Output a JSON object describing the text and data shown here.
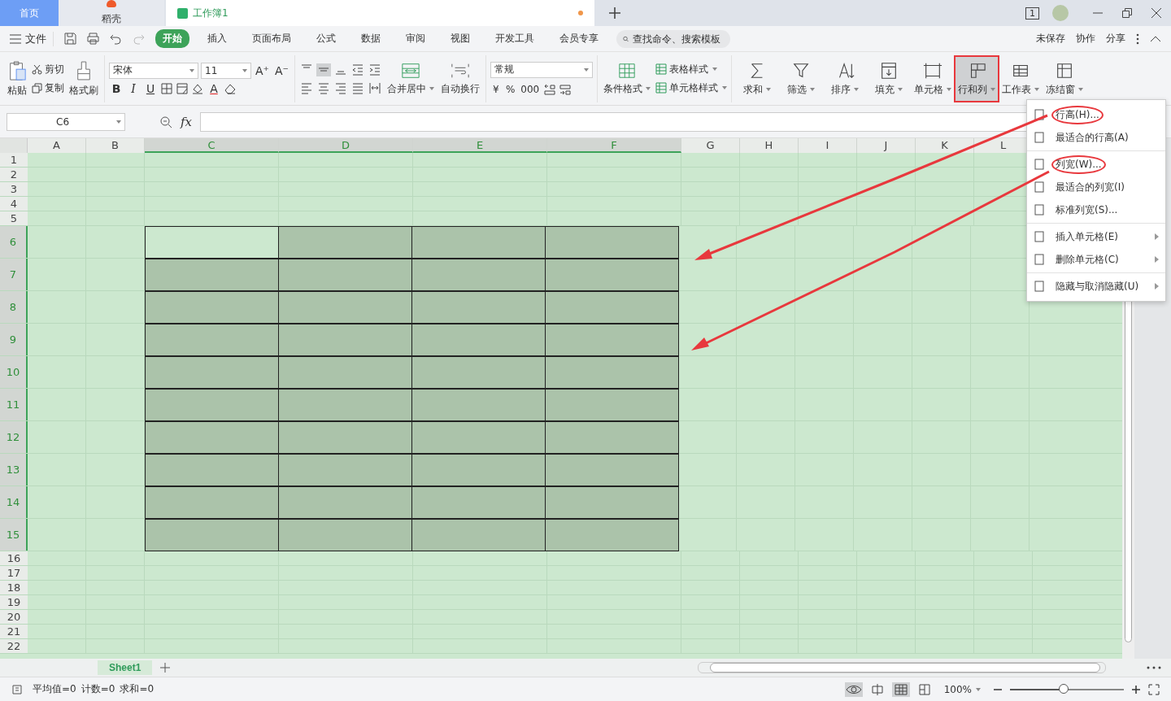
{
  "doc_tabs": [
    {
      "kind": "home",
      "label": "首页",
      "selected": false
    },
    {
      "kind": "app",
      "label": "稻壳",
      "selected": false
    },
    {
      "kind": "sheet",
      "label": "工作簿1",
      "selected": true,
      "unsaved": true
    }
  ],
  "window_badge": "1",
  "menu_bar": {
    "file": "文件",
    "tabs": [
      {
        "label": "开始",
        "selected": true
      },
      {
        "label": "插入",
        "selected": false
      },
      {
        "label": "页面布局",
        "selected": false
      },
      {
        "label": "公式",
        "selected": false
      },
      {
        "label": "数据",
        "selected": false
      },
      {
        "label": "审阅",
        "selected": false
      },
      {
        "label": "视图",
        "selected": false
      },
      {
        "label": "开发工具",
        "selected": false
      },
      {
        "label": "会员专享",
        "selected": false
      }
    ],
    "search": {
      "placeholder": "查找命令、搜索模板"
    },
    "actions": [
      "未保存",
      "协作",
      "分享"
    ]
  },
  "ribbon": {
    "font_size_buttons": [
      "A⁺",
      "A⁻"
    ],
    "font_style_buttons": [
      "B",
      "I",
      "U"
    ],
    "font_color": "A",
    "number_buttons": [
      "¥",
      "%",
      "000"
    ],
    "paste": "粘贴",
    "cut": "剪切",
    "copy": "复制",
    "format_painter": "格式刷",
    "font": "宋体",
    "font_size": "11",
    "merge": "合并居中",
    "wrap": "自动换行",
    "number_format": "常规",
    "styles": [
      {
        "label": "条件格式",
        "kind": "large"
      },
      {
        "label": "表格样式",
        "kind": "small"
      },
      {
        "label": "单元格样式",
        "kind": "small"
      }
    ],
    "editing": [
      {
        "label": "求和",
        "highlighted": false
      },
      {
        "label": "筛选",
        "highlighted": false
      },
      {
        "label": "排序",
        "highlighted": false
      },
      {
        "label": "填充",
        "highlighted": false
      },
      {
        "label": "单元格",
        "highlighted": false
      },
      {
        "label": "行和列",
        "highlighted": true
      },
      {
        "label": "工作表",
        "highlighted": false
      },
      {
        "label": "冻结窗",
        "highlighted": false
      }
    ]
  },
  "formula_bar": {
    "name_box": "C6",
    "fx": "fx"
  },
  "columns": [
    {
      "label": "A",
      "selected": false
    },
    {
      "label": "B",
      "selected": false
    },
    {
      "label": "C",
      "selected": true
    },
    {
      "label": "D",
      "selected": true
    },
    {
      "label": "E",
      "selected": true
    },
    {
      "label": "F",
      "selected": true
    },
    {
      "label": "G",
      "selected": false
    },
    {
      "label": "H",
      "selected": false
    },
    {
      "label": "I",
      "selected": false
    },
    {
      "label": "J",
      "selected": false
    },
    {
      "label": "K",
      "selected": false
    },
    {
      "label": "L",
      "selected": false
    }
  ],
  "rows": [
    {
      "label": "1",
      "kind": "short",
      "selected": false
    },
    {
      "label": "2",
      "kind": "short",
      "selected": false
    },
    {
      "label": "3",
      "kind": "short",
      "selected": false
    },
    {
      "label": "4",
      "kind": "short",
      "selected": false
    },
    {
      "label": "5",
      "kind": "short",
      "selected": false
    },
    {
      "label": "6",
      "kind": "tall",
      "selected": true
    },
    {
      "label": "7",
      "kind": "tall",
      "selected": true
    },
    {
      "label": "8",
      "kind": "tall",
      "selected": true
    },
    {
      "label": "9",
      "kind": "tall",
      "selected": true
    },
    {
      "label": "10",
      "kind": "tall",
      "selected": true
    },
    {
      "label": "11",
      "kind": "tall",
      "selected": true
    },
    {
      "label": "12",
      "kind": "tall",
      "selected": true
    },
    {
      "label": "13",
      "kind": "tall",
      "selected": true
    },
    {
      "label": "14",
      "kind": "tall",
      "selected": true
    },
    {
      "label": "15",
      "kind": "tall",
      "selected": true
    },
    {
      "label": "16",
      "kind": "short",
      "selected": false
    },
    {
      "label": "17",
      "kind": "short",
      "selected": false
    },
    {
      "label": "18",
      "kind": "short",
      "selected": false
    },
    {
      "label": "19",
      "kind": "short",
      "selected": false
    },
    {
      "label": "20",
      "kind": "short",
      "selected": false
    },
    {
      "label": "21",
      "kind": "short",
      "selected": false
    },
    {
      "label": "22",
      "kind": "short",
      "selected": false
    }
  ],
  "context_menu": [
    [
      {
        "label": "行高(H)...",
        "circled": true,
        "submenu": false
      },
      {
        "label": "最适合的行高(A)",
        "circled": false,
        "submenu": false
      }
    ],
    [
      {
        "label": "列宽(W)...",
        "circled": true,
        "submenu": false
      },
      {
        "label": "最适合的列宽(I)",
        "circled": false,
        "submenu": false
      },
      {
        "label": "标准列宽(S)...",
        "circled": false,
        "submenu": false
      }
    ],
    [
      {
        "label": "插入单元格(E)",
        "circled": false,
        "submenu": true
      },
      {
        "label": "删除单元格(C)",
        "circled": false,
        "submenu": true
      }
    ],
    [
      {
        "label": "隐藏与取消隐藏(U)",
        "circled": false,
        "submenu": true
      }
    ]
  ],
  "sheet_tabs": [
    {
      "label": "Sheet1",
      "selected": true
    }
  ],
  "status_bar": {
    "stats": [
      "平均值=0",
      "计数=0",
      "求和=0"
    ],
    "zoom": "100%",
    "zoom_level": {
      "level": 0.47
    }
  }
}
